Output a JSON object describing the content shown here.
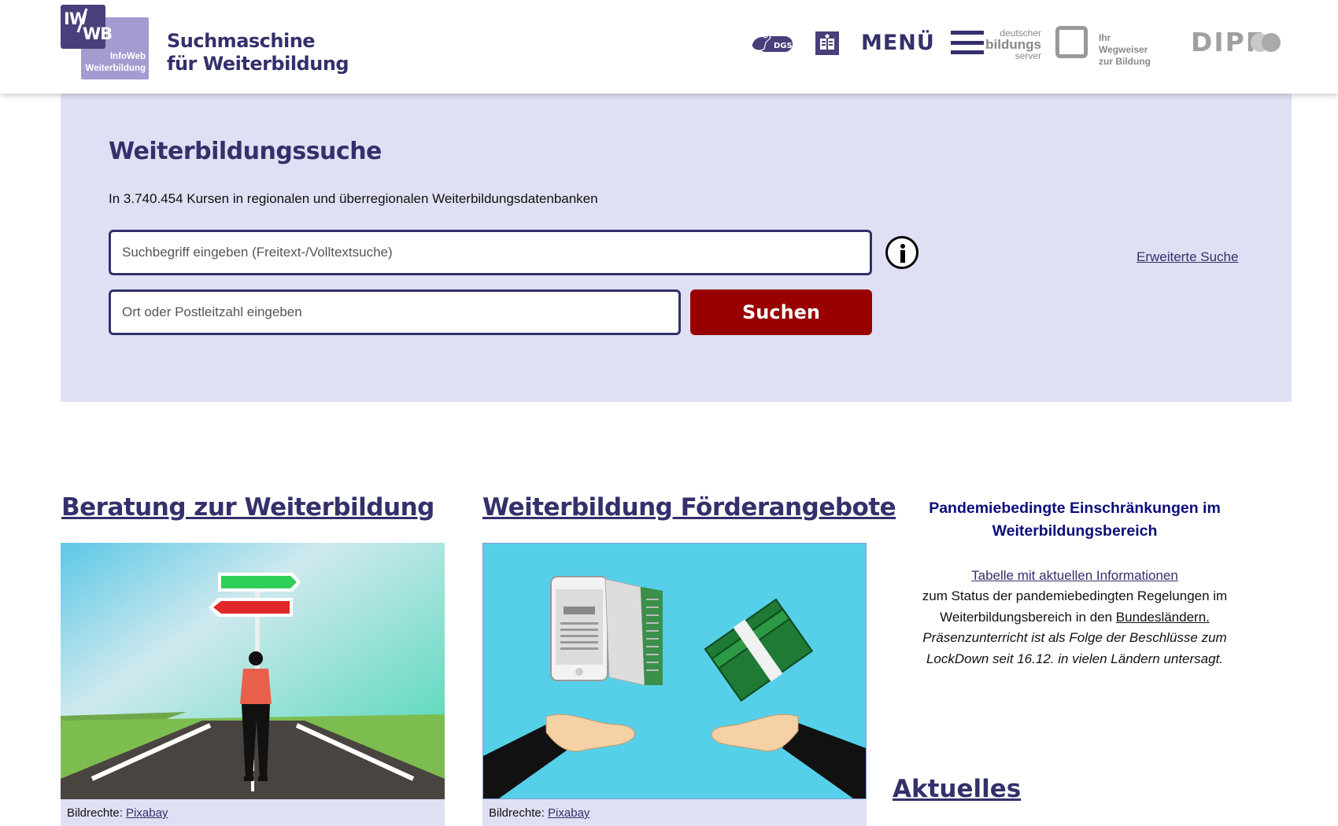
{
  "header": {
    "logo_line1": "IW",
    "logo_line2": "WB",
    "logo_small1": "InfoWeb",
    "logo_small2": "Weiterbildung",
    "title_line1": "Suchmaschine",
    "title_line2": "für Weiterbildung",
    "dgs_label": "DGS",
    "menu_label": "MENÜ",
    "dbs_line1": "deutscher",
    "dbs_line2": "bildungs",
    "dbs_line3": "server",
    "dbs_tag1": "Ihr Wegweiser",
    "dbs_tag2": "zur Bildung",
    "dipf_label": "DIPF"
  },
  "search": {
    "title": "Weiterbildungssuche",
    "subtitle": "In 3.740.454 Kursen in regionalen und überregionalen Weiterbildungsdatenbanken",
    "query_placeholder": "Suchbegriff eingeben (Freitext-/Volltextsuche)",
    "location_placeholder": "Ort oder Postleitzahl eingeben",
    "submit_label": "Suchen",
    "advanced_label": "Erweiterte Suche"
  },
  "columns": {
    "beratung": {
      "heading": "Beratung zur Weiterbildung",
      "caption_prefix": "Bildrechte:",
      "caption_link": "Pixabay"
    },
    "foerder": {
      "heading": "Weiterbildung Förderangebote",
      "caption_prefix": "Bildrechte:",
      "caption_link": "Pixabay"
    },
    "pandemie": {
      "title": "Pandemiebedingte Einschränkungen im Weiterbildungsbereich",
      "link": "Tabelle mit aktuellen Informationen",
      "text_part1": "zum Status der pandemiebedingten Regelungen im Weiterbildungsbereich in den ",
      "text_link": "Bundesländern.",
      "italic": "Präsenzunterricht ist als Folge der Beschlüsse zum LockDown seit 16.12. in vielen Ländern untersagt."
    },
    "aktuelles": "Aktuelles"
  },
  "colors": {
    "brand": "#33306b",
    "panel": "#dfe0f3",
    "button": "#990000"
  }
}
